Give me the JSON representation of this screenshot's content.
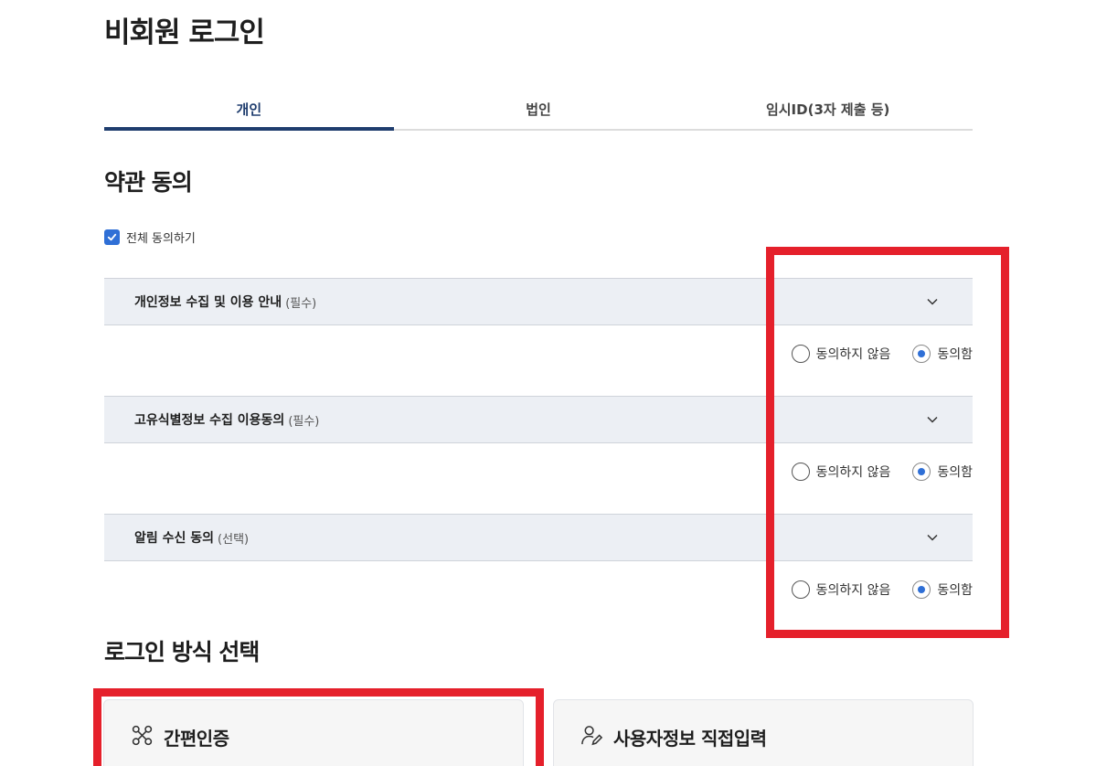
{
  "page": {
    "title": "비회원 로그인"
  },
  "tabs": [
    {
      "label": "개인",
      "active": true
    },
    {
      "label": "법인",
      "active": false
    },
    {
      "label": "임시ID(3자 제출 등)",
      "active": false
    }
  ],
  "terms": {
    "title": "약관 동의",
    "all_agree_label": "전체 동의하기",
    "all_agree_checked": true,
    "items": [
      {
        "title": "개인정보 수집 및 이용 안내",
        "tag": "(필수)",
        "disagree_label": "동의하지 않음",
        "agree_label": "동의함",
        "selected": "agree"
      },
      {
        "title": "고유식별정보 수집 이용동의",
        "tag": "(필수)",
        "disagree_label": "동의하지 않음",
        "agree_label": "동의함",
        "selected": "agree"
      },
      {
        "title": "알림 수신 동의",
        "tag": "(선택)",
        "disagree_label": "동의하지 않음",
        "agree_label": "동의함",
        "selected": "agree"
      }
    ]
  },
  "login_method": {
    "title": "로그인 방식 선택",
    "options": [
      {
        "label": "간편인증",
        "icon": "simple-auth-icon"
      },
      {
        "label": "사용자정보 직접입력",
        "icon": "user-edit-icon"
      }
    ]
  },
  "colors": {
    "accent": "#1f3d6e",
    "radio": "#2f6fd6",
    "highlight": "#e5202b"
  }
}
